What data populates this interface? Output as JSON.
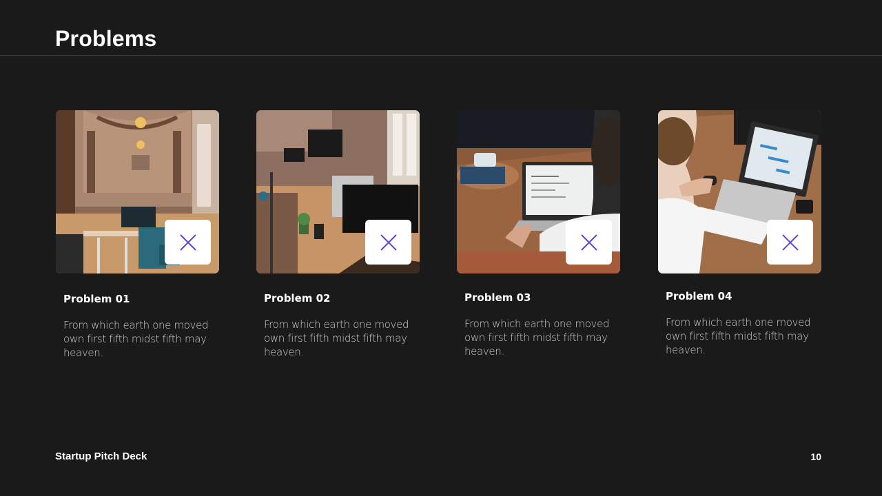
{
  "slide": {
    "title": "Problems",
    "footer_left": "Startup Pitch Deck",
    "page_number": "10"
  },
  "colors": {
    "background": "#1a1a1b",
    "accent": "#5b4bd3",
    "badge": "#ffffff"
  },
  "problems": [
    {
      "title": "Problem 01",
      "body": "From which earth one moved own first fifth midst fifth may heaven.",
      "photo": "office-hall-with-arched-ceiling-and-desks",
      "icon": "close-icon"
    },
    {
      "title": "Problem 02",
      "body": "From which earth one moved own first fifth midst fifth may heaven.",
      "photo": "open-office-with-desks-and-monitors",
      "icon": "close-icon"
    },
    {
      "title": "Problem 03",
      "body": "From which earth one moved own first fifth midst fifth may heaven.",
      "photo": "person-working-on-laptop-at-wooden-table",
      "icon": "close-icon"
    },
    {
      "title": "Problem 04",
      "body": "From which earth one moved own first fifth midst fifth may heaven.",
      "photo": "man-at-desk-with-laptop-and-keyboard",
      "icon": "close-icon"
    }
  ]
}
